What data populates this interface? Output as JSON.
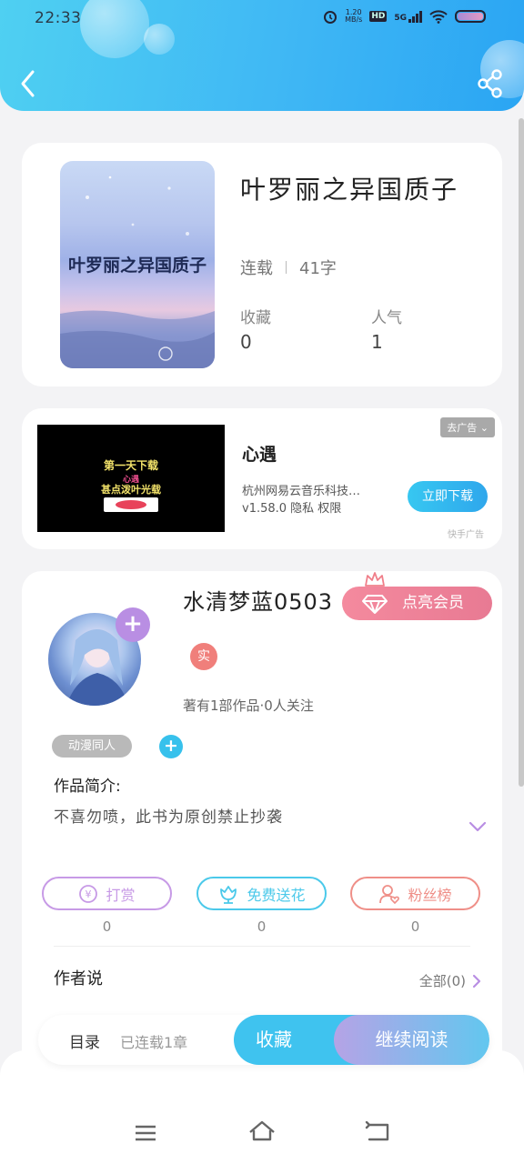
{
  "status_bar": {
    "time": "22:33",
    "net_speed_top": "1.20",
    "net_speed_unit": "MB/s",
    "hd": "HD",
    "signal": "5G"
  },
  "header": {
    "back_icon": "back-arrow-icon",
    "share_icon": "share-icon"
  },
  "book": {
    "cover_text": "叶罗丽之异国质子",
    "title": "叶罗丽之异国质子",
    "status": "连载",
    "word_count": "41字",
    "favorites_label": "收藏",
    "favorites_value": "0",
    "popularity_label": "人气",
    "popularity_value": "1"
  },
  "ad": {
    "image_line1": "第一天下载",
    "image_line2": "心遇",
    "image_line3": "甚点泼叶光载",
    "tag": "去广告",
    "title": "心遇",
    "company": "杭州网易云音乐科技…",
    "version": "v1.58.0 隐私 权限",
    "download_label": "立即下载",
    "source": "快手广告"
  },
  "author": {
    "name": "水清梦蓝0503",
    "vip_label": "点亮会员",
    "verified_badge": "实",
    "meta": "著有1部作品·0人关注",
    "genre_tag": "动漫同人",
    "intro_label": "作品简介:",
    "intro_text": "不喜勿喷，此书为原创禁止抄袭"
  },
  "actions": [
    {
      "label": "打赏",
      "count": "0",
      "color": "#c79ae6",
      "icon": "coin-icon"
    },
    {
      "label": "免费送花",
      "count": "0",
      "color": "#4bc9ea",
      "icon": "flower-icon"
    },
    {
      "label": "粉丝榜",
      "count": "0",
      "color": "#ef8f88",
      "icon": "fan-rank-icon"
    }
  ],
  "author_says": {
    "label": "作者说",
    "all_label": "全部(0)"
  },
  "bottom_bar": {
    "toc_label": "目录",
    "toc_status": "已连载1章",
    "collect_label": "收藏",
    "read_label": "继续阅读"
  },
  "nav_bar": {
    "menu_icon": "menu-icon",
    "home_icon": "home-icon",
    "back_icon": "back-icon"
  }
}
